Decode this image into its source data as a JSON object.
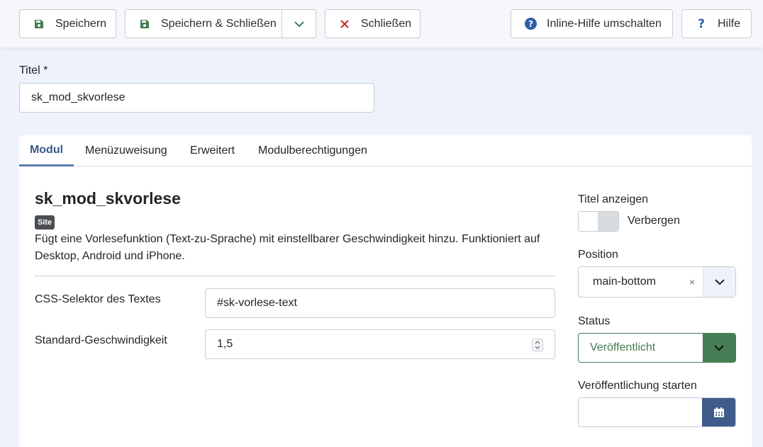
{
  "toolbar": {
    "save_label": "Speichern",
    "save_close_label": "Speichern & Schließen",
    "close_label": "Schließen",
    "inline_help_label": "Inline-Hilfe umschalten",
    "help_label": "Hilfe",
    "save_icon_color": "#457d54",
    "close_icon_color": "#c52827",
    "help_icon_color": "#2f5ea8"
  },
  "title_field": {
    "label": "Titel *",
    "value": "sk_mod_skvorlese"
  },
  "tabs": [
    {
      "label": "Modul",
      "active": true
    },
    {
      "label": "Menüzuweisung",
      "active": false
    },
    {
      "label": "Erweitert",
      "active": false
    },
    {
      "label": "Modulberechtigungen",
      "active": false
    }
  ],
  "module": {
    "name": "sk_mod_skvorlese",
    "badge": "Site",
    "description": "Fügt eine Vorlesefunktion (Text-zu-Sprache) mit einstellbarer Geschwindigkeit hinzu. Funktioniert auf Desktop, Android und iPhone."
  },
  "fields": {
    "css_selector": {
      "label": "CSS-Selektor des Textes",
      "value": "#sk-vorlese-text"
    },
    "speed": {
      "label": "Standard-Geschwindigkeit",
      "value": "1,5"
    }
  },
  "sidebar": {
    "show_title": {
      "label": "Titel anzeigen",
      "state_text": "Verbergen"
    },
    "position": {
      "label": "Position",
      "value": "main-bottom",
      "clear": "×"
    },
    "status": {
      "label": "Status",
      "value": "Veröffentlicht"
    },
    "publish_start": {
      "label": "Veröffentlichung starten",
      "value": ""
    }
  },
  "colors": {
    "primary": "#3e5b8a",
    "success": "#457d54"
  }
}
